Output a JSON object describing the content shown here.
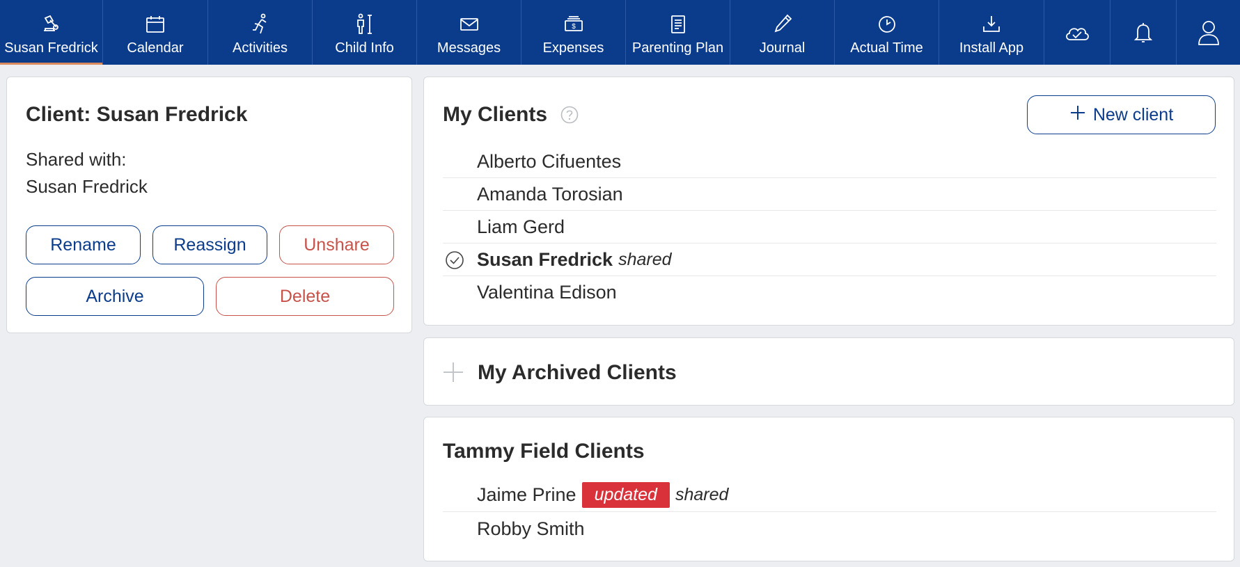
{
  "nav": {
    "items": [
      {
        "label": "Susan Fredrick",
        "icon": "gavel-icon"
      },
      {
        "label": "Calendar",
        "icon": "calendar-icon"
      },
      {
        "label": "Activities",
        "icon": "running-icon"
      },
      {
        "label": "Child Info",
        "icon": "child-info-icon"
      },
      {
        "label": "Messages",
        "icon": "envelope-icon"
      },
      {
        "label": "Expenses",
        "icon": "money-icon"
      },
      {
        "label": "Parenting Plan",
        "icon": "document-icon"
      },
      {
        "label": "Journal",
        "icon": "pen-icon"
      },
      {
        "label": "Actual Time",
        "icon": "clock-icon"
      },
      {
        "label": "Install App",
        "icon": "download-icon"
      }
    ],
    "icon_only": [
      "cloud-check-icon",
      "bell-icon",
      "user-icon"
    ],
    "active_color": "#d9895c",
    "background": "#0b3c8c"
  },
  "client_panel": {
    "title": "Client: Susan Fredrick",
    "shared_label": "Shared with:",
    "shared_name": "Susan Fredrick",
    "buttons": {
      "rename": "Rename",
      "reassign": "Reassign",
      "unshare": "Unshare",
      "archive": "Archive",
      "delete": "Delete"
    }
  },
  "my_clients": {
    "title": "My Clients",
    "new_client_label": "New client",
    "clients": [
      {
        "name": "Alberto Cifuentes"
      },
      {
        "name": "Amanda Torosian"
      },
      {
        "name": "Liam Gerd"
      },
      {
        "name": "Susan Fredrick",
        "tag": "shared",
        "selected": true
      },
      {
        "name": "Valentina Edison"
      }
    ]
  },
  "archived": {
    "title": "My Archived Clients"
  },
  "tammy": {
    "title": "Tammy Field Clients",
    "clients": [
      {
        "name": "Jaime Prine",
        "badge": "updated",
        "tag": "shared"
      },
      {
        "name": "Robby Smith"
      }
    ],
    "badge_color": "#d9323a"
  }
}
